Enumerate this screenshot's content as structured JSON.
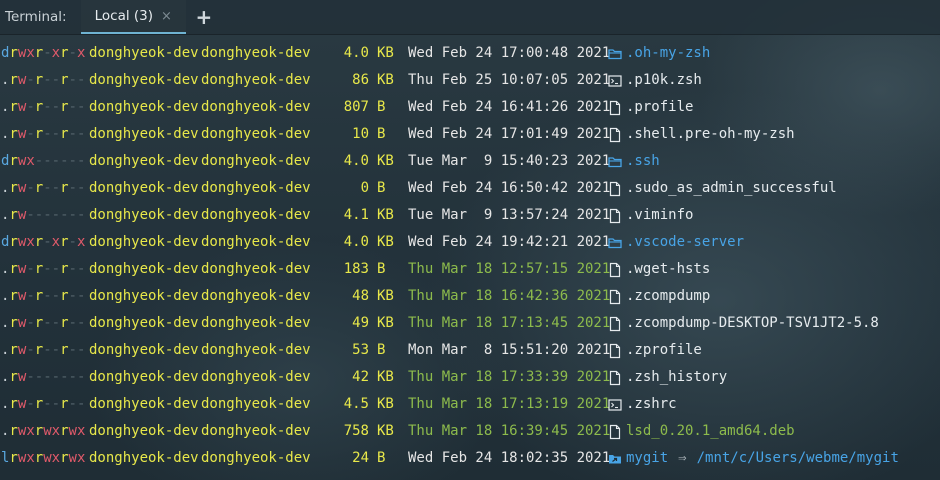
{
  "tabbar": {
    "panel_label": "Terminal:",
    "tab_label": "Local (3)",
    "close_glyph": "×",
    "new_tab_glyph": "+"
  },
  "colors": {
    "background": "#23323a",
    "owner": "#e8e84a",
    "dir": "#48a4e6",
    "recent_date": "#8dbb4c",
    "perm_write": "#e05a6a",
    "tab_underline": "#6fb3d2"
  },
  "entries": [
    {
      "perm": "drwxr-xr-x",
      "owner": "donghyeok-dev",
      "group": "donghyeok-dev",
      "size": "4.0",
      "unit": "KB",
      "date": "Wed Feb 24 17:00:48 2021",
      "recent": false,
      "icon": "folder-icon",
      "name": ".oh-my-zsh",
      "kind": "dir"
    },
    {
      "perm": ".rw-r--r--",
      "owner": "donghyeok-dev",
      "group": "donghyeok-dev",
      "size": "86",
      "unit": "KB",
      "date": "Thu Feb 25 10:07:05 2021",
      "recent": false,
      "icon": "terminal-icon",
      "name": ".p10k.zsh",
      "kind": "file"
    },
    {
      "perm": ".rw-r--r--",
      "owner": "donghyeok-dev",
      "group": "donghyeok-dev",
      "size": "807",
      "unit": "B",
      "date": "Wed Feb 24 16:41:26 2021",
      "recent": false,
      "icon": "file-icon",
      "name": ".profile",
      "kind": "file"
    },
    {
      "perm": ".rw-r--r--",
      "owner": "donghyeok-dev",
      "group": "donghyeok-dev",
      "size": "10",
      "unit": "B",
      "date": "Wed Feb 24 17:01:49 2021",
      "recent": false,
      "icon": "file-icon",
      "name": ".shell.pre-oh-my-zsh",
      "kind": "file"
    },
    {
      "perm": "drwx------",
      "owner": "donghyeok-dev",
      "group": "donghyeok-dev",
      "size": "4.0",
      "unit": "KB",
      "date": "Tue Mar  9 15:40:23 2021",
      "recent": false,
      "icon": "folder-icon",
      "name": ".ssh",
      "kind": "dir"
    },
    {
      "perm": ".rw-r--r--",
      "owner": "donghyeok-dev",
      "group": "donghyeok-dev",
      "size": "0",
      "unit": "B",
      "date": "Wed Feb 24 16:50:42 2021",
      "recent": false,
      "icon": "file-icon",
      "name": ".sudo_as_admin_successful",
      "kind": "file"
    },
    {
      "perm": ".rw-------",
      "owner": "donghyeok-dev",
      "group": "donghyeok-dev",
      "size": "4.1",
      "unit": "KB",
      "date": "Tue Mar  9 13:57:24 2021",
      "recent": false,
      "icon": "file-icon",
      "name": ".viminfo",
      "kind": "file"
    },
    {
      "perm": "drwxr-xr-x",
      "owner": "donghyeok-dev",
      "group": "donghyeok-dev",
      "size": "4.0",
      "unit": "KB",
      "date": "Wed Feb 24 19:42:21 2021",
      "recent": false,
      "icon": "folder-icon",
      "name": ".vscode-server",
      "kind": "dir"
    },
    {
      "perm": ".rw-r--r--",
      "owner": "donghyeok-dev",
      "group": "donghyeok-dev",
      "size": "183",
      "unit": "B",
      "date": "Thu Mar 18 12:57:15 2021",
      "recent": true,
      "icon": "file-icon",
      "name": ".wget-hsts",
      "kind": "file"
    },
    {
      "perm": ".rw-r--r--",
      "owner": "donghyeok-dev",
      "group": "donghyeok-dev",
      "size": "48",
      "unit": "KB",
      "date": "Thu Mar 18 16:42:36 2021",
      "recent": true,
      "icon": "file-icon",
      "name": ".zcompdump",
      "kind": "file"
    },
    {
      "perm": ".rw-r--r--",
      "owner": "donghyeok-dev",
      "group": "donghyeok-dev",
      "size": "49",
      "unit": "KB",
      "date": "Thu Mar 18 17:13:45 2021",
      "recent": true,
      "icon": "file-icon",
      "name": ".zcompdump-DESKTOP-TSV1JT2-5.8",
      "kind": "file"
    },
    {
      "perm": ".rw-r--r--",
      "owner": "donghyeok-dev",
      "group": "donghyeok-dev",
      "size": "53",
      "unit": "B",
      "date": "Mon Mar  8 15:51:20 2021",
      "recent": false,
      "icon": "file-icon",
      "name": ".zprofile",
      "kind": "file"
    },
    {
      "perm": ".rw-------",
      "owner": "donghyeok-dev",
      "group": "donghyeok-dev",
      "size": "42",
      "unit": "KB",
      "date": "Thu Mar 18 17:33:39 2021",
      "recent": true,
      "icon": "file-icon",
      "name": ".zsh_history",
      "kind": "file"
    },
    {
      "perm": ".rw-r--r--",
      "owner": "donghyeok-dev",
      "group": "donghyeok-dev",
      "size": "4.5",
      "unit": "KB",
      "date": "Thu Mar 18 17:13:19 2021",
      "recent": true,
      "icon": "terminal-icon",
      "name": ".zshrc",
      "kind": "file"
    },
    {
      "perm": ".rwxrwxrwx",
      "owner": "donghyeok-dev",
      "group": "donghyeok-dev",
      "size": "758",
      "unit": "KB",
      "date": "Thu Mar 18 16:39:45 2021",
      "recent": true,
      "icon": "file-icon",
      "name": "lsd_0.20.1_amd64.deb",
      "kind": "exec"
    },
    {
      "perm": "lrwxrwxrwx",
      "owner": "donghyeok-dev",
      "group": "donghyeok-dev",
      "size": "24",
      "unit": "B",
      "date": "Wed Feb 24 18:02:35 2021",
      "recent": false,
      "icon": "symlink-folder-icon",
      "name": "mygit",
      "kind": "link",
      "arrow": "⇒",
      "target": "/mnt/c/Users/webme/mygit"
    }
  ]
}
